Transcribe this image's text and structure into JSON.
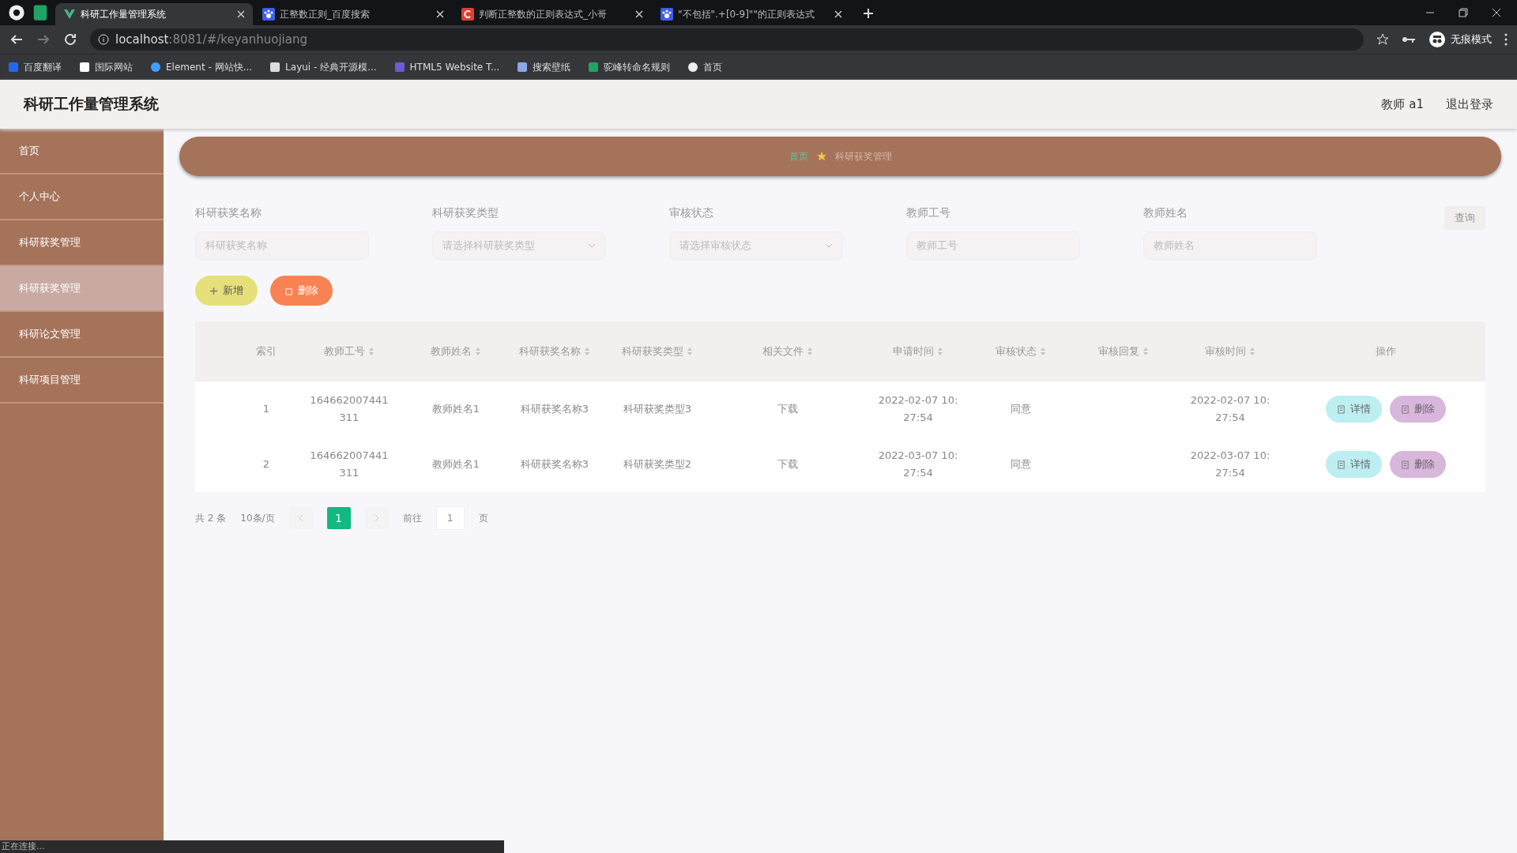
{
  "browser": {
    "tabs": [
      {
        "title": "科研工作量管理系统",
        "selected": true,
        "kind": "vue"
      },
      {
        "title": "正整数正则_百度搜索",
        "selected": false,
        "kind": "baidu"
      },
      {
        "title": "判断正整数的正则表达式_小哥",
        "selected": false,
        "kind": "csdn"
      },
      {
        "title": "\"不包括\".+[0-9]\"\"的正则表达式",
        "selected": false,
        "kind": "baidu"
      }
    ],
    "url_host": "localhost",
    "url_path": ":8081/#/keyanhuojiang",
    "profile_label": "无痕模式",
    "bookmarks": [
      {
        "label": "百度翻译",
        "kind": "translate"
      },
      {
        "label": "国际网站",
        "kind": "flag"
      },
      {
        "label": "Element - 网站快...",
        "kind": "element"
      },
      {
        "label": "Layui - 经典开源模...",
        "kind": "layui"
      },
      {
        "label": "HTML5 Website T...",
        "kind": "html"
      },
      {
        "label": "搜索壁纸",
        "kind": "wall"
      },
      {
        "label": "驼峰转命名规则",
        "kind": "sheet"
      },
      {
        "label": "首页",
        "kind": "globe"
      }
    ]
  },
  "header": {
    "title": "科研工作量管理系统",
    "user": "教师 a1",
    "logout": "退出登录"
  },
  "sidebar": {
    "items": [
      {
        "label": "首页",
        "selected": false
      },
      {
        "label": "个人中心",
        "selected": false
      },
      {
        "label": "科研获奖管理",
        "selected": false
      },
      {
        "label": "科研获奖管理",
        "selected": true
      },
      {
        "label": "科研论文管理",
        "selected": false
      },
      {
        "label": "科研项目管理",
        "selected": false
      }
    ]
  },
  "breadcrumb": {
    "home": "首页",
    "current": "科研获奖管理"
  },
  "filters": [
    {
      "label": "科研获奖名称",
      "placeholder": "科研获奖名称",
      "kind": "text"
    },
    {
      "label": "科研获奖类型",
      "placeholder": "请选择科研获奖类型",
      "kind": "select"
    },
    {
      "label": "审核状态",
      "placeholder": "请选择审核状态",
      "kind": "select"
    },
    {
      "label": "教师工号",
      "placeholder": "教师工号",
      "kind": "text"
    },
    {
      "label": "教师姓名",
      "placeholder": "教师姓名",
      "kind": "text"
    }
  ],
  "search_button": "查询",
  "actions": [
    {
      "label": "新增",
      "kind": "add"
    },
    {
      "label": "删除",
      "kind": "delete"
    }
  ],
  "table": {
    "columns": [
      {
        "label": "索引",
        "sortable": false
      },
      {
        "label": "教师工号",
        "sortable": true
      },
      {
        "label": "教师姓名",
        "sortable": true
      },
      {
        "label": "科研获奖名称",
        "sortable": true
      },
      {
        "label": "科研获奖类型",
        "sortable": true
      },
      {
        "label": "相关文件",
        "sortable": true
      },
      {
        "label": "申请时间",
        "sortable": true
      },
      {
        "label": "审核状态",
        "sortable": true
      },
      {
        "label": "审核回复",
        "sortable": true
      },
      {
        "label": "审核时间",
        "sortable": true
      },
      {
        "label": "操作",
        "sortable": false
      }
    ],
    "rows": [
      {
        "cells": [
          "1",
          "164662007441311",
          "教师姓名1",
          "科研获奖名称3",
          "科研获奖类型3",
          "下载",
          "2022-02-07 10:27:54",
          "同意",
          "",
          "2022-02-07 10:27:54"
        ],
        "buttons": [
          {
            "label": "详情",
            "kind": "detail"
          },
          {
            "label": "删除",
            "kind": "delete"
          }
        ]
      },
      {
        "cells": [
          "2",
          "164662007441311",
          "教师姓名1",
          "科研获奖名称3",
          "科研获奖类型2",
          "下载",
          "2022-03-07 10:27:54",
          "同意",
          "",
          "2022-03-07 10:27:54"
        ],
        "buttons": [
          {
            "label": "详情",
            "kind": "detail"
          },
          {
            "label": "删除",
            "kind": "delete"
          }
        ]
      }
    ]
  },
  "pagination": {
    "total": "共 2 条",
    "page_size": "10条/页",
    "pages": [
      {
        "label": "1",
        "selected": true
      }
    ],
    "goto_label": "前往",
    "goto_value": "1",
    "goto_unit": "页"
  },
  "status_text": "正在连接..."
}
